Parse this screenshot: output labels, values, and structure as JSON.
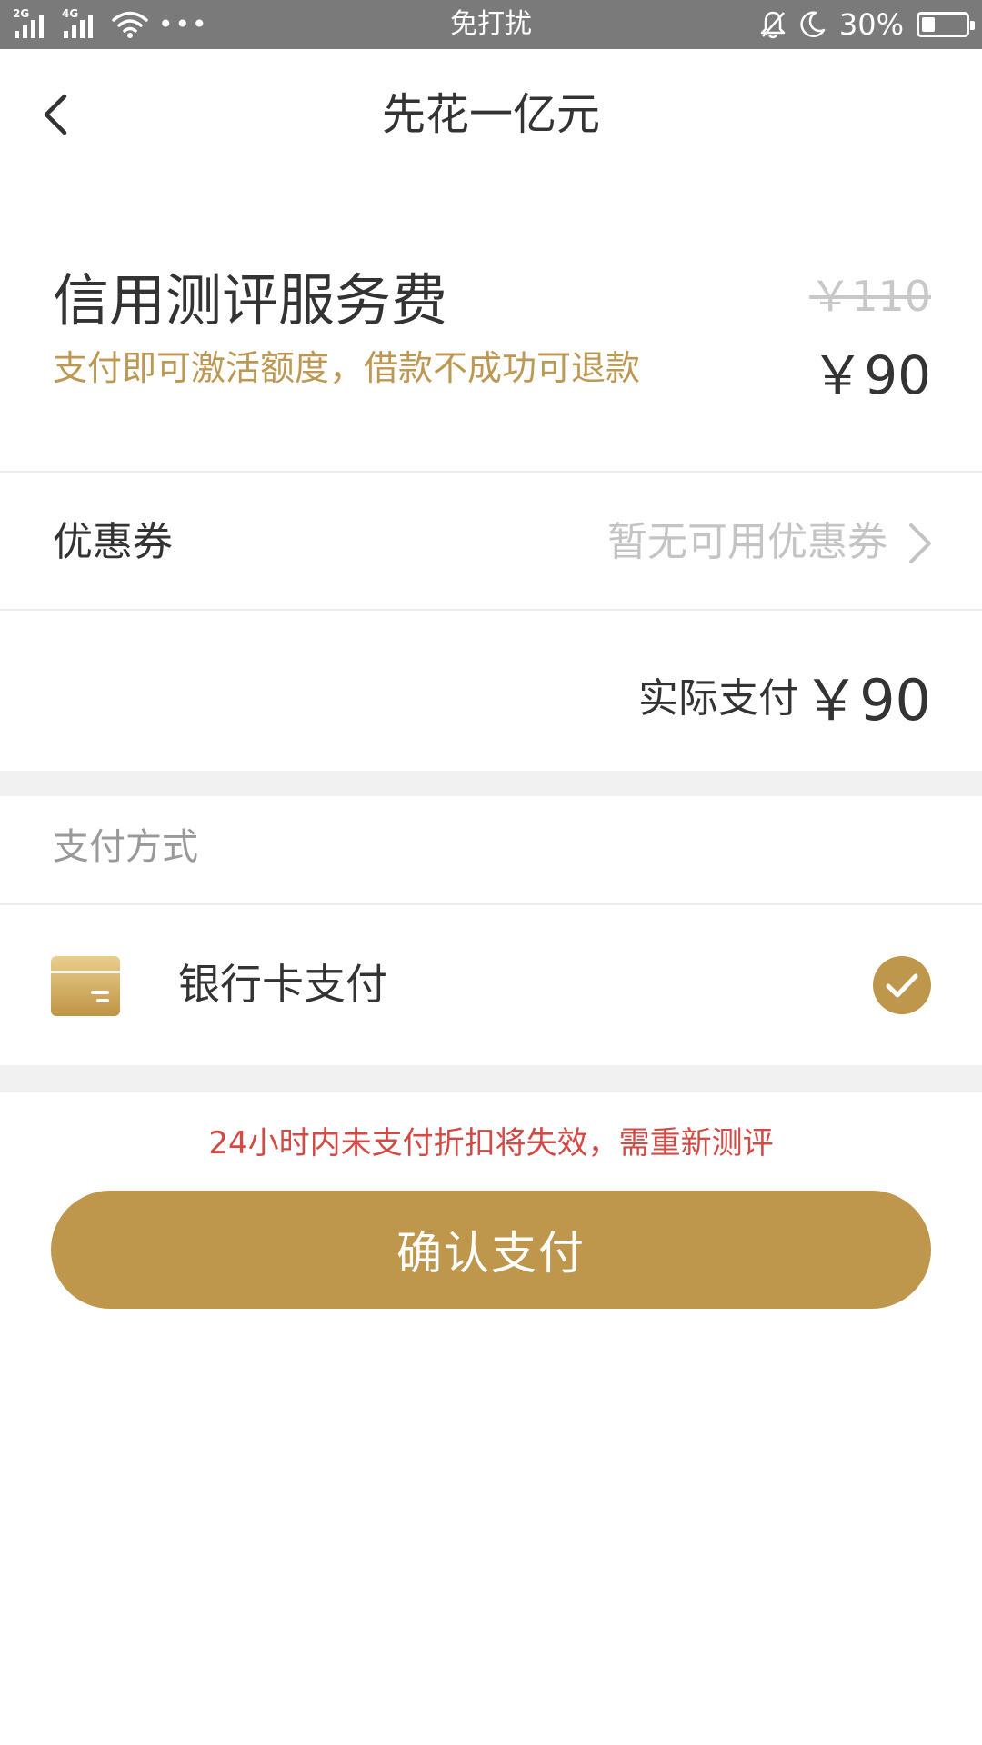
{
  "status_bar": {
    "signal_1_tag": "2G",
    "signal_2_tag": "4G",
    "overflow": "•••",
    "mode": "免打扰",
    "battery_percent": "30%",
    "battery_level": 0.3,
    "icons": [
      "signal-icon",
      "wifi-icon",
      "bell-off-icon",
      "moon-icon",
      "battery-icon"
    ]
  },
  "header": {
    "title": "先花一亿元",
    "back_icon": "chevron-left-icon"
  },
  "fee": {
    "title": "信用测评服务费",
    "subtitle": "支付即可激活额度，借款不成功可退款",
    "original_price": "￥110",
    "price": "￥90"
  },
  "coupon": {
    "label": "优惠券",
    "value": "暂无可用优惠券",
    "chevron_icon": "chevron-right-icon"
  },
  "actual": {
    "label": "实际支付",
    "price": "￥90"
  },
  "payment": {
    "section_label": "支付方式",
    "method_name": "银行卡支付",
    "method_icon": "bank-card-icon",
    "selected": true
  },
  "notice": "24小时内未支付折扣将失效，需重新测评",
  "confirm_label": "确认支付",
  "colors": {
    "accent": "#bf974c",
    "subtitle_gold": "#bd9852",
    "notice_red": "#d34a45",
    "status_bar": "#7a7a7a"
  }
}
